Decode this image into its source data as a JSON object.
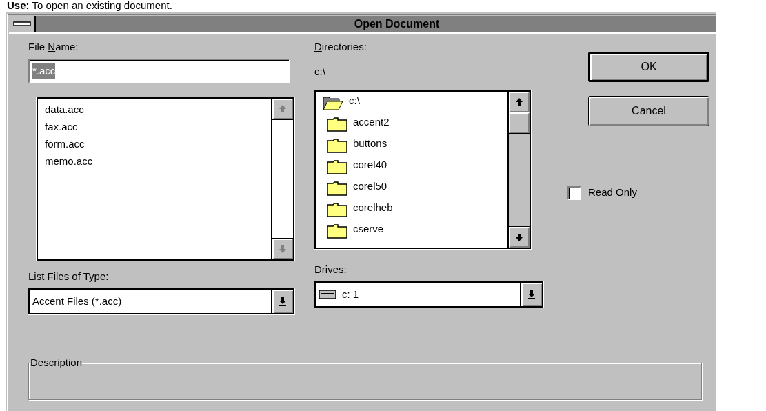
{
  "caption": {
    "lead": "Use:",
    "text": "To open an existing document."
  },
  "window": {
    "title": "Open Document"
  },
  "file_name": {
    "label": {
      "before": "File ",
      "key": "N",
      "after": "ame:"
    },
    "value": "*.acc",
    "text_selected": true
  },
  "files": [
    "data.acc",
    "fax.acc",
    "form.acc",
    "memo.acc"
  ],
  "directories": {
    "label": {
      "key": "D",
      "after": "irectories:"
    },
    "path": "c:\\",
    "tree": [
      {
        "label": "c:\\",
        "open": true,
        "children": [
          {
            "label": "accent2",
            "open": false
          },
          {
            "label": "buttons",
            "open": false
          },
          {
            "label": "corel40",
            "open": false
          },
          {
            "label": "corel50",
            "open": false
          },
          {
            "label": "corelheb",
            "open": false
          },
          {
            "label": "cserve",
            "open": false
          }
        ]
      }
    ]
  },
  "buttons": [
    {
      "label": "OK",
      "default": true
    },
    {
      "label": "Cancel",
      "default": false
    }
  ],
  "read_only": {
    "label": {
      "key": "R",
      "after": "ead Only"
    },
    "checked": false
  },
  "file_type": {
    "label": {
      "before": "List Files of ",
      "key": "T",
      "after": "ype:"
    },
    "value": "Accent Files (*.acc)"
  },
  "drives": {
    "label": {
      "before": "Dri",
      "key": "v",
      "after": "es:"
    },
    "value": "c: 1"
  },
  "description": {
    "label": "Description"
  }
}
